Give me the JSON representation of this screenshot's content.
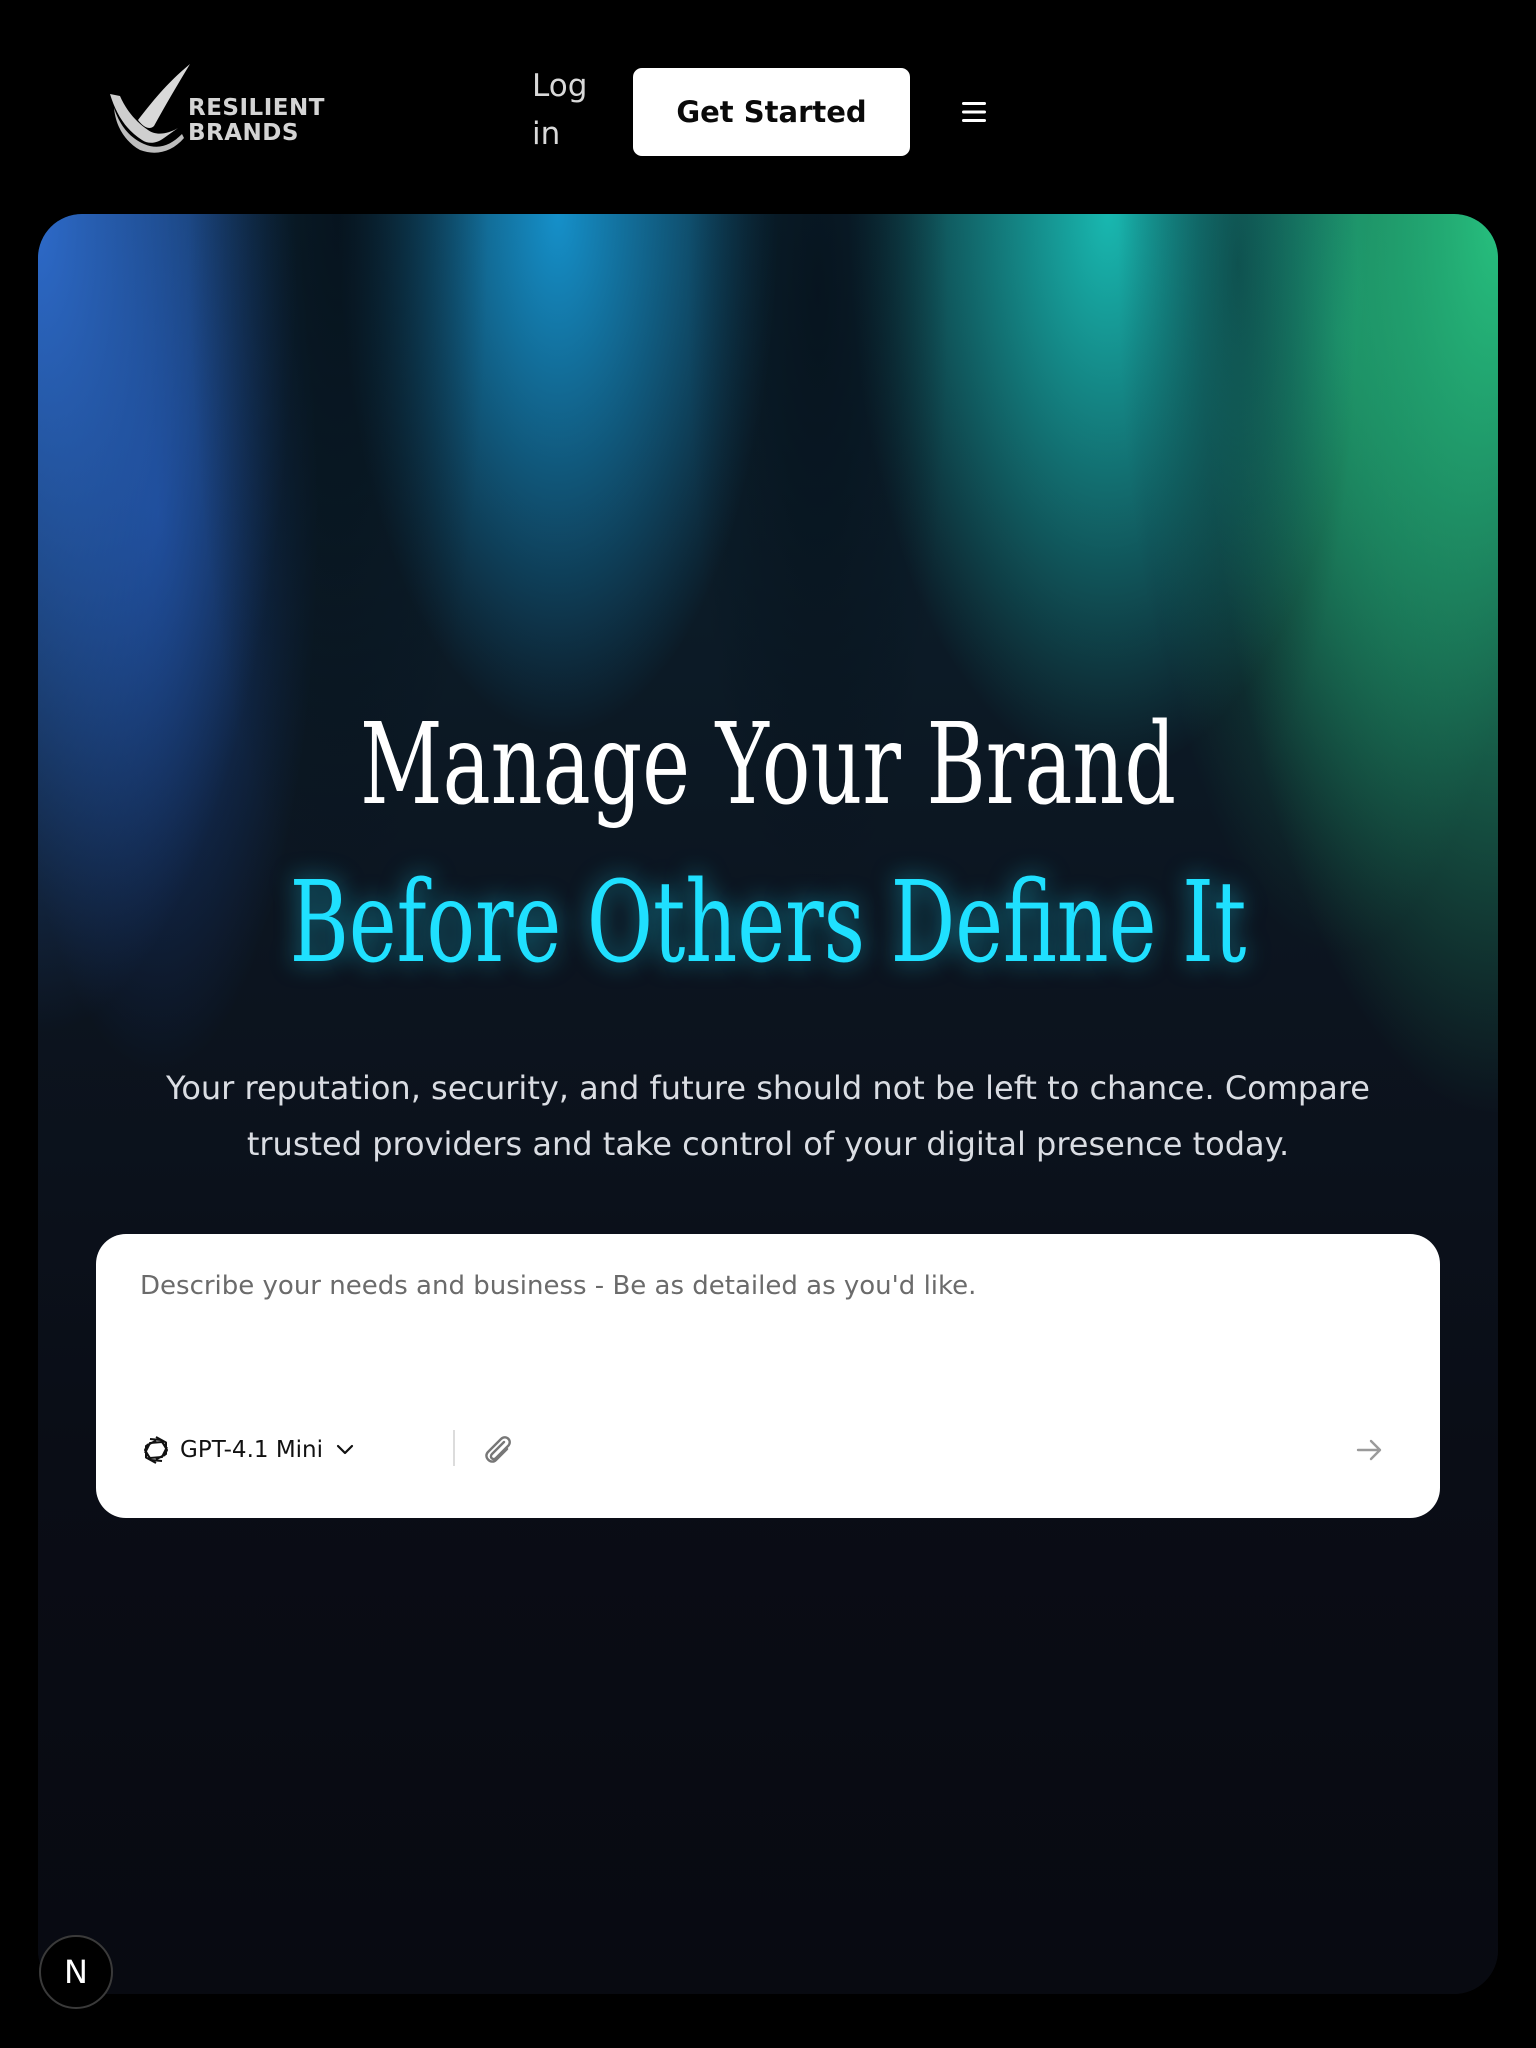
{
  "header": {
    "logo": {
      "line1": "RESILIENT",
      "line2": "BRANDS",
      "icon": "checkmark-logo-icon"
    },
    "login_label": "Log in",
    "cta_label": "Get Started",
    "menu_icon": "hamburger-menu-icon"
  },
  "hero": {
    "headline_line1": "Manage Your Brand",
    "headline_line2": "Before Others Define It",
    "subtext": "Your reputation, security, and future should not be left to chance. Compare trusted providers and take control of your digital presence today.",
    "prompt": {
      "placeholder": "Describe your needs and business - Be as detailed as you'd like.",
      "value": "",
      "model_label": "GPT-4.1 Mini",
      "model_icon": "openai-logo-icon",
      "attach_icon": "paperclip-icon",
      "send_icon": "arrow-right-icon"
    }
  },
  "badge": {
    "label": "N"
  },
  "colors": {
    "background": "#000000",
    "accent_cyan": "#1fe0ff",
    "cta_background": "#ffffff",
    "gradient_blue": "#2f6ed2",
    "gradient_teal": "#1ac8be",
    "gradient_green": "#28c882"
  }
}
